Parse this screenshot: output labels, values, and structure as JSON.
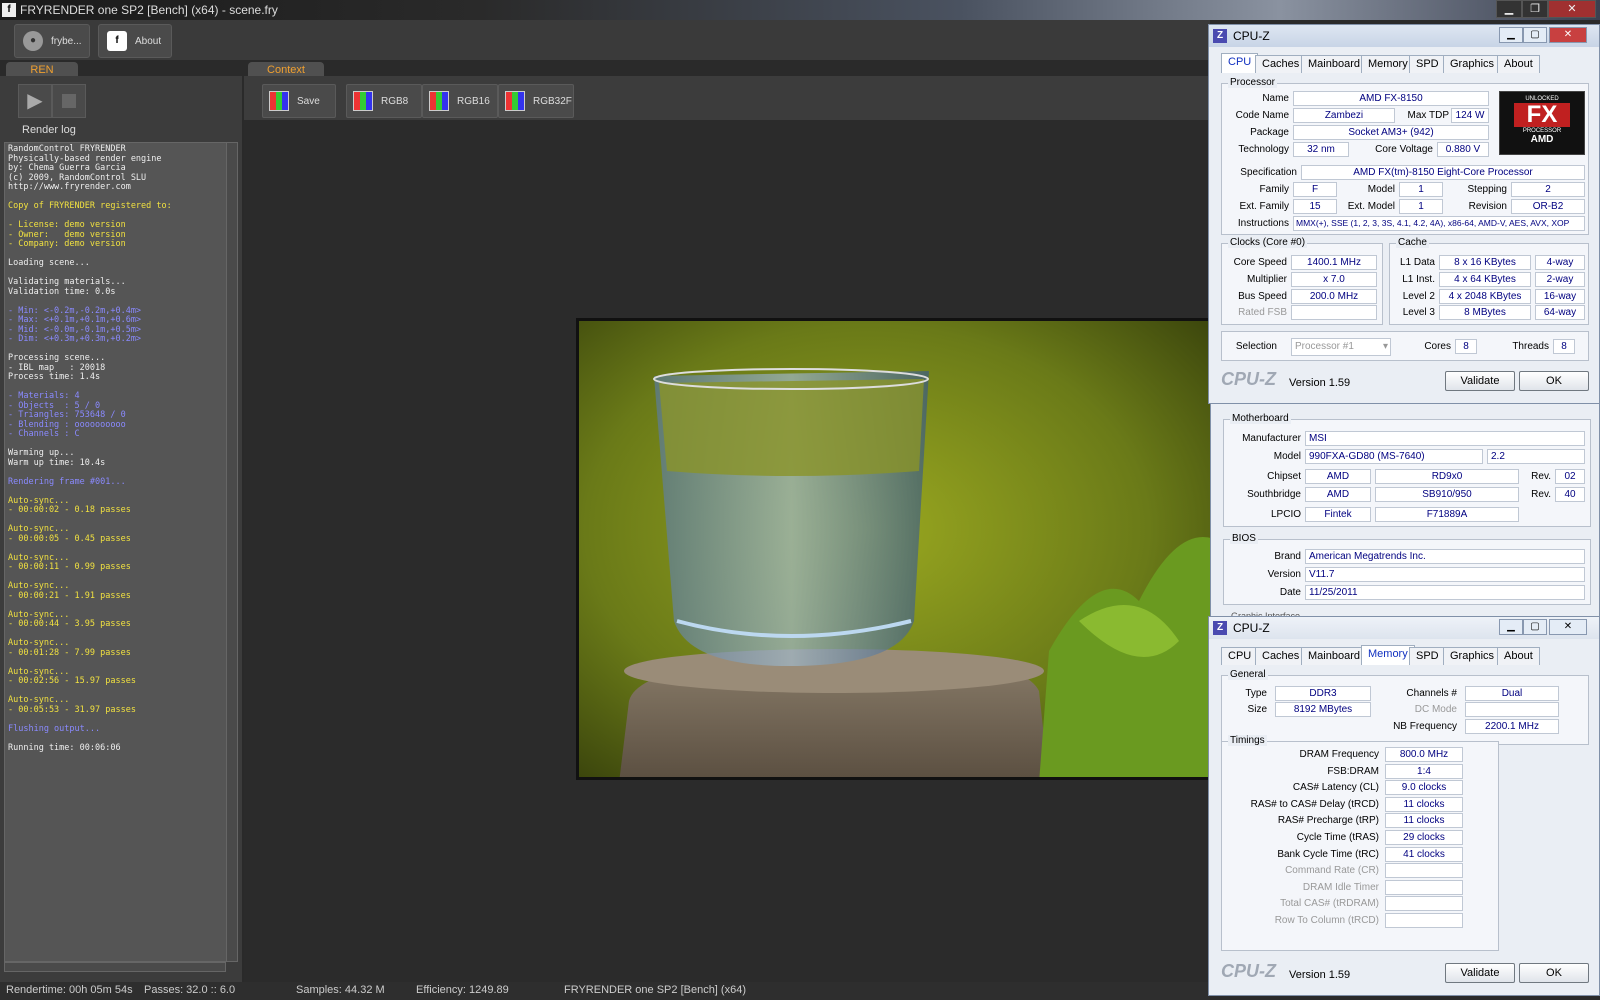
{
  "app": {
    "title": "FRYRENDER one SP2 [Bench] (x64) - scene.fry",
    "icon": "fryrender-icon"
  },
  "toolbar": {
    "btn1": "frybe...",
    "btn2": "About"
  },
  "tabs": {
    "ren": "REN",
    "context": "Context"
  },
  "leftpanel": {
    "render_log_label": "Render log"
  },
  "context": {
    "save": "Save",
    "rgb8": "RGB8",
    "rgb16": "RGB16",
    "rgb32f": "RGB32F"
  },
  "log": [
    {
      "t": "RandomControl FRYRENDER",
      "c": "w"
    },
    {
      "t": "Physically-based render engine",
      "c": "w"
    },
    {
      "t": "by: Chema Guerra Garcia",
      "c": "w"
    },
    {
      "t": "(c) 2009, RandomControl SLU",
      "c": "w"
    },
    {
      "t": "http://www.fryrender.com",
      "c": "w"
    },
    {
      "t": "",
      "c": "w"
    },
    {
      "t": "Copy of FRYRENDER registered to:",
      "c": "y"
    },
    {
      "t": "",
      "c": "w"
    },
    {
      "t": "- License: demo version",
      "c": "y"
    },
    {
      "t": "- Owner:   demo version",
      "c": "y"
    },
    {
      "t": "- Company: demo version",
      "c": "y"
    },
    {
      "t": "",
      "c": "w"
    },
    {
      "t": "Loading scene...",
      "c": "w"
    },
    {
      "t": "",
      "c": "w"
    },
    {
      "t": "Validating materials...",
      "c": "w"
    },
    {
      "t": "Validation time: 0.0s",
      "c": "w"
    },
    {
      "t": "",
      "c": "w"
    },
    {
      "t": "- Min: <-0.2m,-0.2m,+0.4m>",
      "c": "b"
    },
    {
      "t": "- Max: <+0.1m,+0.1m,+0.6m>",
      "c": "b"
    },
    {
      "t": "- Mid: <-0.0m,-0.1m,+0.5m>",
      "c": "b"
    },
    {
      "t": "- Dim: <+0.3m,+0.3m,+0.2m>",
      "c": "b"
    },
    {
      "t": "",
      "c": "w"
    },
    {
      "t": "Processing scene...",
      "c": "w"
    },
    {
      "t": "- IBL map   : 20018",
      "c": "w"
    },
    {
      "t": "Process time: 1.4s",
      "c": "w"
    },
    {
      "t": "",
      "c": "w"
    },
    {
      "t": "- Materials: 4",
      "c": "b"
    },
    {
      "t": "- Objects  : 5 / 0",
      "c": "b"
    },
    {
      "t": "- Triangles: 753648 / 0",
      "c": "b"
    },
    {
      "t": "- Blending : oooooooooo",
      "c": "b"
    },
    {
      "t": "- Channels : C",
      "c": "b"
    },
    {
      "t": "",
      "c": "w"
    },
    {
      "t": "Warming up...",
      "c": "w"
    },
    {
      "t": "Warm up time: 10.4s",
      "c": "w"
    },
    {
      "t": "",
      "c": "w"
    },
    {
      "t": "Rendering frame #001...",
      "c": "b"
    },
    {
      "t": "",
      "c": "w"
    },
    {
      "t": "Auto-sync...",
      "c": "y"
    },
    {
      "t": "- 00:00:02 - 0.18 passes",
      "c": "y"
    },
    {
      "t": "",
      "c": "w"
    },
    {
      "t": "Auto-sync...",
      "c": "y"
    },
    {
      "t": "- 00:00:05 - 0.45 passes",
      "c": "y"
    },
    {
      "t": "",
      "c": "w"
    },
    {
      "t": "Auto-sync...",
      "c": "y"
    },
    {
      "t": "- 00:00:11 - 0.99 passes",
      "c": "y"
    },
    {
      "t": "",
      "c": "w"
    },
    {
      "t": "Auto-sync...",
      "c": "y"
    },
    {
      "t": "- 00:00:21 - 1.91 passes",
      "c": "y"
    },
    {
      "t": "",
      "c": "w"
    },
    {
      "t": "Auto-sync...",
      "c": "y"
    },
    {
      "t": "- 00:00:44 - 3.95 passes",
      "c": "y"
    },
    {
      "t": "",
      "c": "w"
    },
    {
      "t": "Auto-sync...",
      "c": "y"
    },
    {
      "t": "- 00:01:28 - 7.99 passes",
      "c": "y"
    },
    {
      "t": "",
      "c": "w"
    },
    {
      "t": "Auto-sync...",
      "c": "y"
    },
    {
      "t": "- 00:02:56 - 15.97 passes",
      "c": "y"
    },
    {
      "t": "",
      "c": "w"
    },
    {
      "t": "Auto-sync...",
      "c": "y"
    },
    {
      "t": "- 00:05:53 - 31.97 passes",
      "c": "y"
    },
    {
      "t": "",
      "c": "w"
    },
    {
      "t": "Flushing output...",
      "c": "b"
    },
    {
      "t": "",
      "c": "w"
    },
    {
      "t": "Running time: 00:06:06",
      "c": "w"
    }
  ],
  "status": {
    "rendertime": "Rendertime:  00h 05m 54s",
    "passes": "Passes:  32.0 :: 6.0",
    "samples": "Samples:   44.32 M",
    "efficiency": "Efficiency:   1249.89",
    "app": "FRYRENDER one SP2 [Bench] (x64)"
  },
  "cpuz": {
    "title": "CPU-Z",
    "version": "Version 1.59",
    "logo": "CPU-Z",
    "validate": "Validate",
    "ok": "OK",
    "tabs": [
      "CPU",
      "Caches",
      "Mainboard",
      "Memory",
      "SPD",
      "Graphics",
      "About"
    ],
    "processor_group": "Processor",
    "name_l": "Name",
    "name": "AMD FX-8150",
    "codename_l": "Code Name",
    "codename": "Zambezi",
    "tdp_l": "Max TDP",
    "tdp": "124 W",
    "package_l": "Package",
    "package": "Socket AM3+ (942)",
    "tech_l": "Technology",
    "tech": "32 nm",
    "cv_l": "Core Voltage",
    "cv": "0.880 V",
    "spec_l": "Specification",
    "spec": "AMD FX(tm)-8150 Eight-Core Processor",
    "family_l": "Family",
    "family": "F",
    "model_l": "Model",
    "model": "1",
    "stepping_l": "Stepping",
    "stepping": "2",
    "extfam_l": "Ext. Family",
    "extfam": "15",
    "extmodel_l": "Ext. Model",
    "extmodel": "1",
    "revision_l": "Revision",
    "revision": "OR-B2",
    "instr_l": "Instructions",
    "instr": "MMX(+), SSE (1, 2, 3, 3S, 4.1, 4.2, 4A), x86-64, AMD-V, AES, AVX, XOP",
    "clocks_group": "Clocks (Core #0)",
    "corespeed_l": "Core Speed",
    "corespeed": "1400.1 MHz",
    "mult_l": "Multiplier",
    "mult": "x 7.0",
    "bus_l": "Bus Speed",
    "bus": "200.0 MHz",
    "fsb_l": "Rated FSB",
    "cache_group": "Cache",
    "l1d_l": "L1 Data",
    "l1d": "8 x 16 KBytes",
    "l1d_w": "4-way",
    "l1i_l": "L1 Inst.",
    "l1i": "4 x 64 KBytes",
    "l1i_w": "2-way",
    "l2_l": "Level 2",
    "l2": "4 x 2048 KBytes",
    "l2_w": "16-way",
    "l3_l": "Level 3",
    "l3": "8 MBytes",
    "l3_w": "64-way",
    "sel_l": "Selection",
    "sel": "Processor #1",
    "cores_l": "Cores",
    "cores": "8",
    "threads_l": "Threads",
    "threads": "8",
    "badge": {
      "top": "UNLOCKED",
      "fx": "FX",
      "proc": "PROCESSOR",
      "amd": "AMD"
    }
  },
  "mb": {
    "mb_group": "Motherboard",
    "manu_l": "Manufacturer",
    "manu": "MSI",
    "model_l": "Model",
    "model": "990FXA-GD80 (MS-7640)",
    "model_rev": "2.2",
    "chipset_l": "Chipset",
    "chipset_v": "AMD",
    "chipset_m": "RD9x0",
    "chipset_rev_l": "Rev.",
    "chipset_rev": "02",
    "sb_l": "Southbridge",
    "sb_v": "AMD",
    "sb_m": "SB910/950",
    "sb_rev_l": "Rev.",
    "sb_rev": "40",
    "lpcio_l": "LPCIO",
    "lpcio_v": "Fintek",
    "lpcio_m": "F71889A",
    "bios_group": "BIOS",
    "brand_l": "Brand",
    "brand": "American Megatrends Inc.",
    "version_l": "Version",
    "version": "V11.7",
    "date_l": "Date",
    "date": "11/25/2011",
    "gi_group": "Graphic Interface"
  },
  "mem": {
    "general_group": "General",
    "type_l": "Type",
    "type": "DDR3",
    "channels_l": "Channels #",
    "channels": "Dual",
    "size_l": "Size",
    "size": "8192 MBytes",
    "dc_l": "DC Mode",
    "nb_l": "NB Frequency",
    "nb": "2200.1 MHz",
    "timings_group": "Timings",
    "rows": [
      {
        "l": "DRAM Frequency",
        "v": "800.0 MHz",
        "dim": false
      },
      {
        "l": "FSB:DRAM",
        "v": "1:4",
        "dim": false
      },
      {
        "l": "CAS# Latency (CL)",
        "v": "9.0 clocks",
        "dim": false
      },
      {
        "l": "RAS# to CAS# Delay (tRCD)",
        "v": "11 clocks",
        "dim": false
      },
      {
        "l": "RAS# Precharge (tRP)",
        "v": "11 clocks",
        "dim": false
      },
      {
        "l": "Cycle Time (tRAS)",
        "v": "29 clocks",
        "dim": false
      },
      {
        "l": "Bank Cycle Time (tRC)",
        "v": "41 clocks",
        "dim": false
      },
      {
        "l": "Command Rate (CR)",
        "v": "",
        "dim": true
      },
      {
        "l": "DRAM Idle Timer",
        "v": "",
        "dim": true
      },
      {
        "l": "Total CAS# (tRDRAM)",
        "v": "",
        "dim": true
      },
      {
        "l": "Row To Column (tRCD)",
        "v": "",
        "dim": true
      }
    ]
  }
}
